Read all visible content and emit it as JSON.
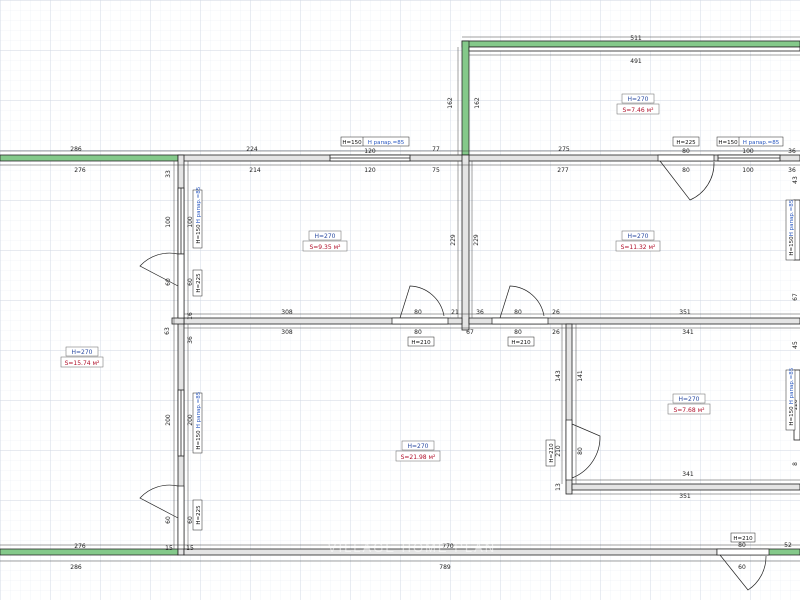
{
  "colors": {
    "wall_fill": "#e4e4e4",
    "wall_stroke": "#222222",
    "exterior": "#84c98a",
    "grid_major": "#cfd6e2",
    "grid_minor": "#e8ecf3",
    "dimension": "#222222",
    "room_area": "#b0102a",
    "room_height": "#2a4aa0"
  },
  "rooms": {
    "top": {
      "height": "H=270",
      "area": "S=7.46 м²"
    },
    "left": {
      "height": "H=270",
      "area": "S=15.74 м²"
    },
    "mid_top": {
      "height": "H=270",
      "area": "S=9.35 м²"
    },
    "right_top": {
      "height": "H=270",
      "area": "S=11.32 м²"
    },
    "center": {
      "height": "H=270",
      "area": "S=21.98 м²"
    },
    "right_mid": {
      "height": "H=270",
      "area": "S=7.68 м²"
    }
  },
  "tags": {
    "h150": "H=150",
    "h210": "H=210",
    "h225": "H=225",
    "sill": "H рапар.=85"
  },
  "watermark": "VILLAGE HOME PLAN",
  "dims": {
    "d511": "511",
    "d491": "491",
    "d162a": "162",
    "d162b": "162",
    "d286a": "286",
    "d224": "224",
    "d120a": "120",
    "d77": "77",
    "d275": "275",
    "d80a": "80",
    "d100a": "100",
    "d36a": "36",
    "d276a": "276",
    "d214": "214",
    "d120b": "120",
    "d75": "75",
    "d277": "277",
    "d80b": "80",
    "d100b": "100",
    "d36b": "36",
    "d33": "33",
    "d100c": "100",
    "d100d": "100",
    "d60a": "60",
    "d60b": "60",
    "d16": "16",
    "d229a": "229",
    "d229b": "229",
    "d308a": "308",
    "d80c": "80",
    "d21": "21",
    "d36c": "36",
    "d80d": "80",
    "d26a": "26",
    "d351a": "351",
    "d308b": "308",
    "d80e": "80",
    "d67": "67",
    "d80f": "80",
    "d26b": "26",
    "d341a": "341",
    "d63": "63",
    "d36d": "36",
    "d143": "143",
    "d141": "141",
    "d200a": "200",
    "d200b": "200",
    "d60c": "60",
    "d60d": "60",
    "d210v": "210",
    "d80g": "80",
    "d341b": "341",
    "d13": "13",
    "d351b": "351",
    "d276b": "276",
    "d15a": "15",
    "d15b": "15",
    "d770": "770",
    "d286b": "286",
    "d789": "789",
    "d80h": "80",
    "d52": "52",
    "d60e": "60",
    "d43": "43",
    "d67b": "67",
    "d45": "45",
    "d120c": "120",
    "d8": "8"
  }
}
